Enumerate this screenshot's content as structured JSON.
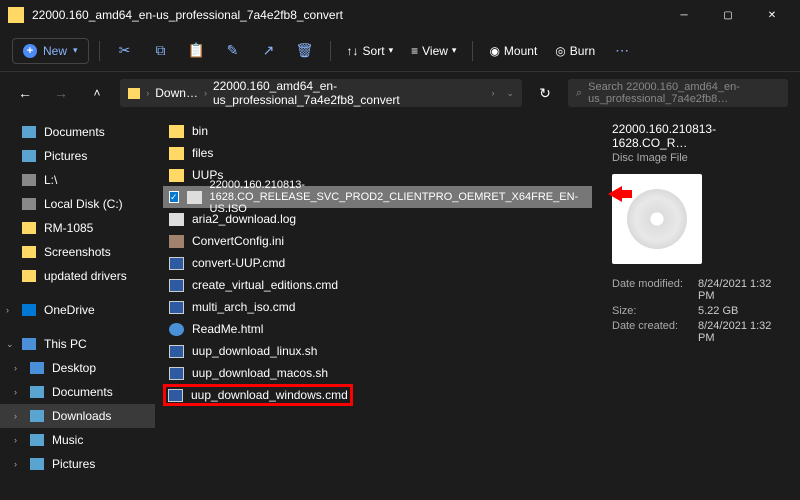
{
  "window": {
    "title": "22000.160_amd64_en-us_professional_7a4e2fb8_convert"
  },
  "toolbar": {
    "new": "New",
    "sort": "Sort",
    "view": "View",
    "mount": "Mount",
    "burn": "Burn"
  },
  "breadcrumb": {
    "seg1": "Down…",
    "seg2": "22000.160_amd64_en-us_professional_7a4e2fb8_convert"
  },
  "search": {
    "placeholder": "Search 22000.160_amd64_en-us_professional_7a4e2fb8…"
  },
  "sidebar": {
    "items": [
      {
        "label": "Documents"
      },
      {
        "label": "Pictures"
      },
      {
        "label": "L:\\"
      },
      {
        "label": "Local Disk (C:)"
      },
      {
        "label": "RM-1085"
      },
      {
        "label": "Screenshots"
      },
      {
        "label": "updated drivers"
      },
      {
        "label": "OneDrive"
      },
      {
        "label": "This PC"
      },
      {
        "label": "Desktop"
      },
      {
        "label": "Documents"
      },
      {
        "label": "Downloads"
      },
      {
        "label": "Music"
      },
      {
        "label": "Pictures"
      }
    ]
  },
  "files": [
    {
      "name": "bin"
    },
    {
      "name": "files"
    },
    {
      "name": "UUPs"
    },
    {
      "name": "22000.160.210813-1628.CO_RELEASE_SVC_PROD2_CLIENTPRO_OEMRET_X64FRE_EN-US.ISO"
    },
    {
      "name": "aria2_download.log"
    },
    {
      "name": "ConvertConfig.ini"
    },
    {
      "name": "convert-UUP.cmd"
    },
    {
      "name": "create_virtual_editions.cmd"
    },
    {
      "name": "multi_arch_iso.cmd"
    },
    {
      "name": "ReadMe.html"
    },
    {
      "name": "uup_download_linux.sh"
    },
    {
      "name": "uup_download_macos.sh"
    },
    {
      "name": "uup_download_windows.cmd"
    }
  ],
  "details": {
    "filename": "22000.160.210813-1628.CO_R…",
    "filetype": "Disc Image File",
    "modified_label": "Date modified:",
    "modified": "8/24/2021 1:32 PM",
    "size_label": "Size:",
    "size": "5.22 GB",
    "created_label": "Date created:",
    "created": "8/24/2021 1:32 PM"
  }
}
